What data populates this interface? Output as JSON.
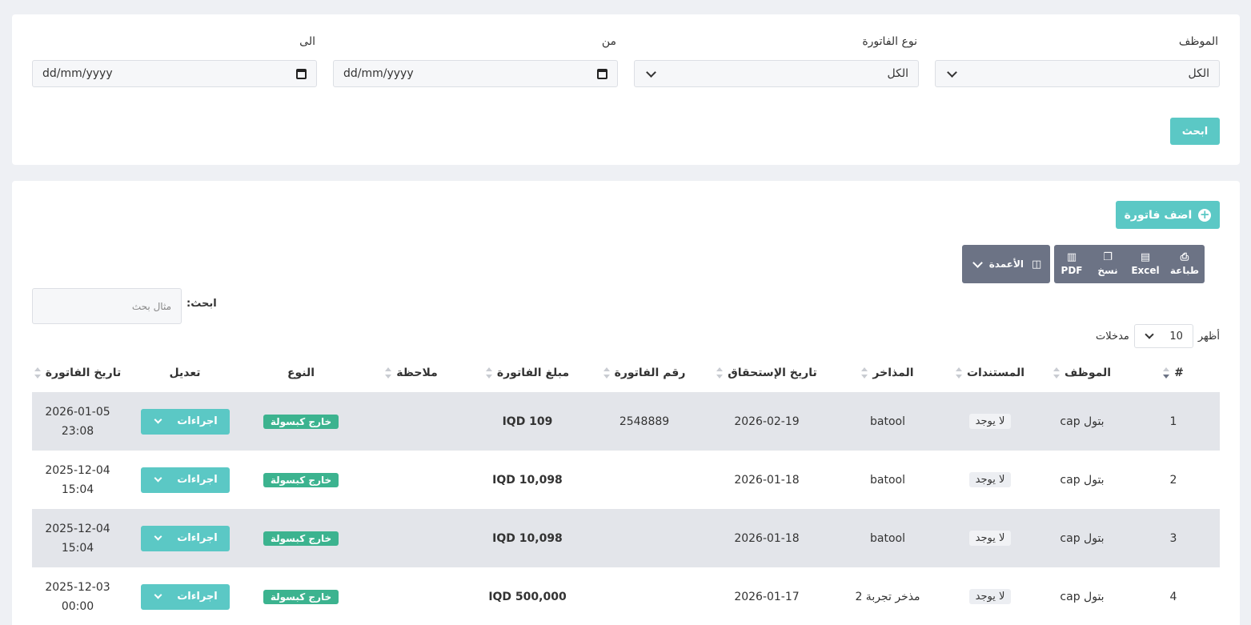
{
  "filters": {
    "employee": {
      "label": "الموظف",
      "value": "الكل"
    },
    "invoice_type": {
      "label": "نوع الفاتورة",
      "value": "الكل"
    },
    "from": {
      "label": "من",
      "placeholder": "dd/mm/yyyy"
    },
    "to": {
      "label": "الى",
      "placeholder": "dd/mm/yyyy"
    },
    "search_button": "ابحث"
  },
  "toolbar": {
    "add_invoice": "اضف فاتورة",
    "print": "طباعة",
    "excel": "Excel",
    "copy": "نسخ",
    "pdf": "PDF",
    "columns": "الأعمدة"
  },
  "table_search": {
    "label": "ابحث:",
    "placeholder": "مثال بحث"
  },
  "length": {
    "prefix": "أظهر",
    "value": "10",
    "suffix": "مدخلات"
  },
  "columns": [
    "#",
    "الموظف",
    "المستندات",
    "المذاخر",
    "تاريخ الإستحقاق",
    "رقم الفاتورة",
    "مبلغ الفاتورة",
    "ملاحظة",
    "النوع",
    "تعديل",
    "تاريخ الفاتورة"
  ],
  "rows": [
    {
      "no": "1",
      "employee": "بتول cap",
      "docs": "لا يوجد",
      "store": "batool",
      "due": "2026-02-19",
      "invoice_no": "2548889",
      "amount": "IQD 109",
      "note": "",
      "type": "خارج كبسولة",
      "action": "اجراءات",
      "date": "2026-01-05",
      "time": "23:08"
    },
    {
      "no": "2",
      "employee": "بتول cap",
      "docs": "لا يوجد",
      "store": "batool",
      "due": "2026-01-18",
      "invoice_no": "",
      "amount": "IQD 10,098",
      "note": "",
      "type": "خارج كبسولة",
      "action": "اجراءات",
      "date": "2025-12-04",
      "time": "15:04"
    },
    {
      "no": "3",
      "employee": "بتول cap",
      "docs": "لا يوجد",
      "store": "batool",
      "due": "2026-01-18",
      "invoice_no": "",
      "amount": "IQD 10,098",
      "note": "",
      "type": "خارج كبسولة",
      "action": "اجراءات",
      "date": "2025-12-04",
      "time": "15:04"
    },
    {
      "no": "4",
      "employee": "بتول cap",
      "docs": "لا يوجد",
      "store": "مذخر تجربة 2",
      "due": "2026-01-17",
      "invoice_no": "",
      "amount": "IQD 500,000",
      "note": "",
      "type": "خارج كبسولة",
      "action": "اجراءات",
      "date": "2025-12-03",
      "time": "00:00"
    }
  ],
  "colors": {
    "accent": "#5bc8c5",
    "type_badge": "#3cb38f",
    "toolbar": "#6c7385"
  }
}
